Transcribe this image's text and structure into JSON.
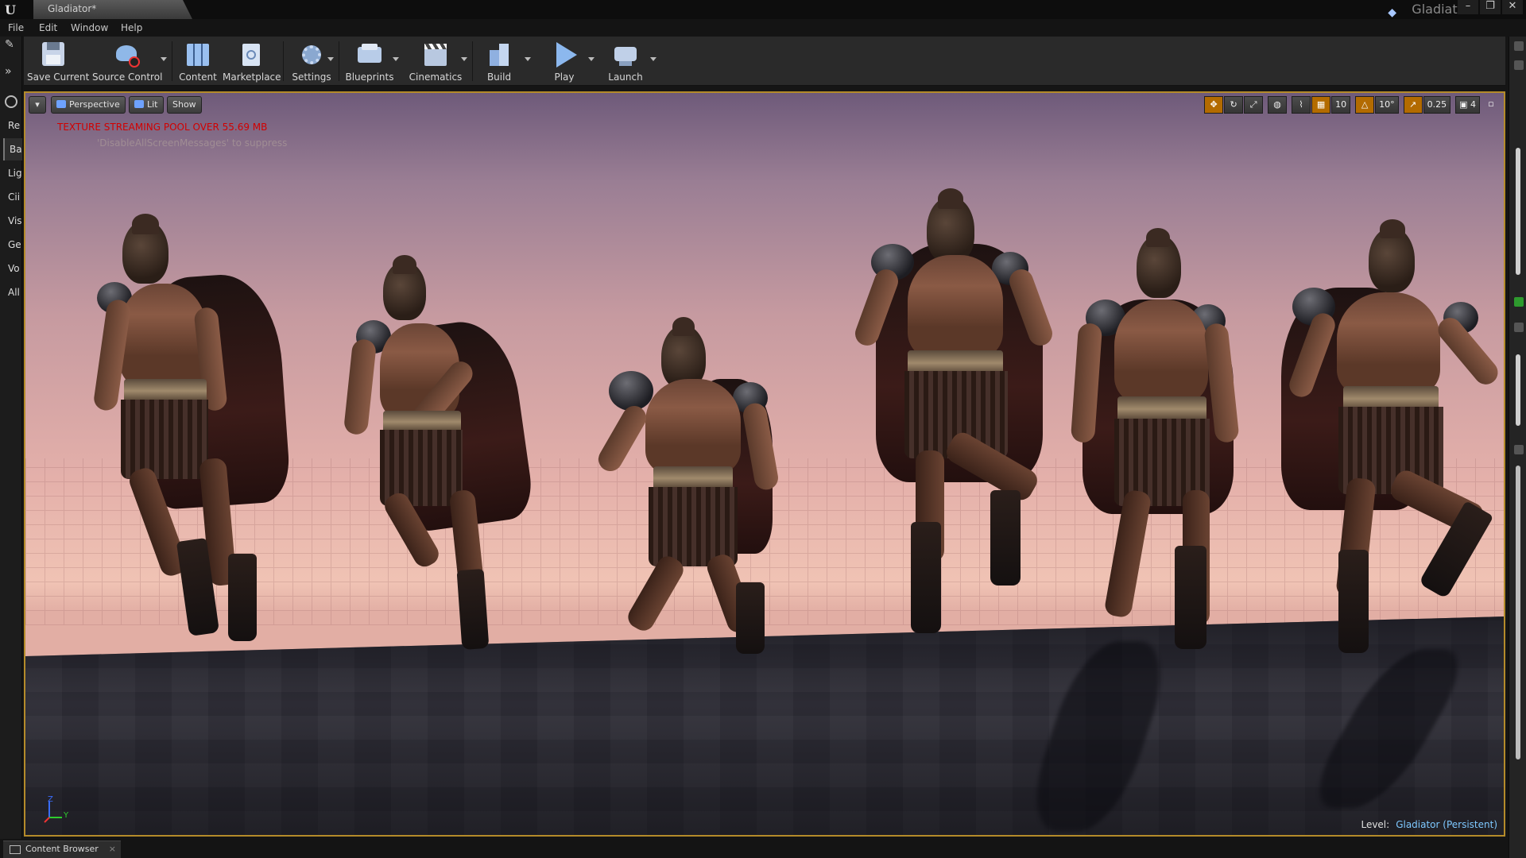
{
  "titlebar": {
    "logo": "U",
    "document_tab": "Gladiator*",
    "project_name": "Gladiator",
    "window_buttons": [
      "–",
      "❐",
      "✕"
    ]
  },
  "menu": [
    "File",
    "Edit",
    "Window",
    "Help"
  ],
  "left_tabs": [
    "Re",
    "Ba",
    "Lig",
    "Cii",
    "Vis",
    "Ge",
    "Vo",
    "All"
  ],
  "toolbar": {
    "items": [
      {
        "label": "Save Current",
        "icon": "save-icon"
      },
      {
        "label": "Source Control",
        "icon": "source-control-icon"
      },
      {
        "label": "Content",
        "icon": "content-icon"
      },
      {
        "label": "Marketplace",
        "icon": "marketplace-icon"
      },
      {
        "label": "Settings",
        "icon": "settings-icon"
      },
      {
        "label": "Blueprints",
        "icon": "blueprints-icon"
      },
      {
        "label": "Cinematics",
        "icon": "cinematics-icon"
      },
      {
        "label": "Build",
        "icon": "build-icon"
      },
      {
        "label": "Play",
        "icon": "play-icon"
      },
      {
        "label": "Launch",
        "icon": "launch-icon"
      }
    ]
  },
  "viewport": {
    "view_mode": "Perspective",
    "lighting": "Lit",
    "show": "Show",
    "grid_snap": "10",
    "rotation_snap": "10°",
    "scale_snap": "0.25",
    "camera_speed": "4",
    "warning": "TEXTURE STREAMING POOL OVER 55.69 MB",
    "warning_hint": "'DisableAllScreenMessages' to suppress",
    "level_label": "Level:",
    "level_name": "Gladiator (Persistent)",
    "axis_y": "Y",
    "axis_z": "Z"
  },
  "bottom": {
    "tab_label": "Content Browser",
    "close": "×"
  },
  "colors": {
    "accent_border": "#b48b2a",
    "warning_red": "#d10000",
    "level_blue": "#7ec8ff",
    "snap_orange": "#b36b00"
  }
}
